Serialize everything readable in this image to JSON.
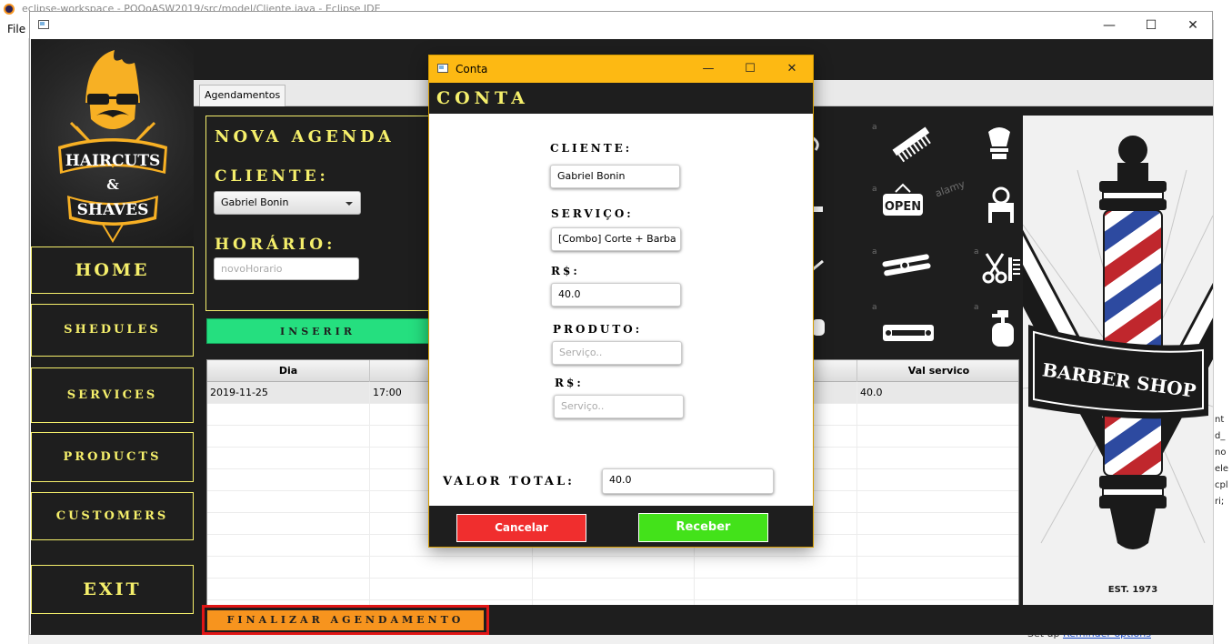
{
  "eclipse": {
    "title": "eclipse-workspace - POOoASW2019/src/model/Cliente.java - Eclipse IDE",
    "menu_file": "File",
    "right_panel_text": [
      "nt",
      "d_",
      "no",
      "ele",
      "cpl",
      "ri;"
    ],
    "bottom_prefix": "Set up",
    "bottom_link": "Reminder options"
  },
  "sidebar": {
    "logo_top": "HAIRCUTS",
    "logo_mid": "&",
    "logo_bottom": "SHAVES",
    "nav": {
      "home": "HOME",
      "schedules": "SHEDULES",
      "services": "SERVICES",
      "products": "PRODUCTS",
      "customers": "CUSTOMERS",
      "exit": "EXIT"
    }
  },
  "tab": {
    "label": "Agendamentos"
  },
  "form": {
    "title": "NOVA AGENDA",
    "cliente_label": "CLIENTE:",
    "cliente_value": "Gabriel Bonin",
    "horario_label": "HORÁRIO:",
    "horario_placeholder": "novoHorario",
    "insert_label": "INSERIR"
  },
  "table": {
    "headers": {
      "dia": "Dia",
      "val_servico": "Val servico"
    },
    "row1": {
      "dia": "2019-11-25",
      "hora": "17:00",
      "val": "40.0"
    }
  },
  "icons_panel": {
    "watermark_a": "a",
    "watermark_alamy": "alamy",
    "open_sign": "OPEN"
  },
  "barber_image": {
    "sign": "BARBER SHOP",
    "est": "EST. 1973"
  },
  "finalizar": "FINALIZAR AGENDAMENTO",
  "dialog": {
    "title": "Conta",
    "header": "CONTA",
    "cliente_label": "CLIENTE:",
    "cliente_value": "Gabriel Bonin",
    "servico_label": "SERVIÇO:",
    "servico_value": "[Combo] Corte + Barba",
    "rs1_label": "R$:",
    "rs1_value": "40.0",
    "produto_label": "PRODUTO:",
    "produto_placeholder": "Serviço..",
    "rs2_label": "R$:",
    "rs2_placeholder": "Serviço..",
    "total_label": "VALOR TOTAL:",
    "total_value": "40.0",
    "cancel": "Cancelar",
    "confirm": "Receber"
  },
  "colors": {
    "accent_yellow": "#f5ef6b",
    "dialog_title_yellow": "#fdb913",
    "cancel_red": "#f02e2e",
    "confirm_green": "#43e21a",
    "insert_green": "#25df7f",
    "finalize_orange": "#f7941e",
    "dark_bg": "#1e1e1e"
  }
}
